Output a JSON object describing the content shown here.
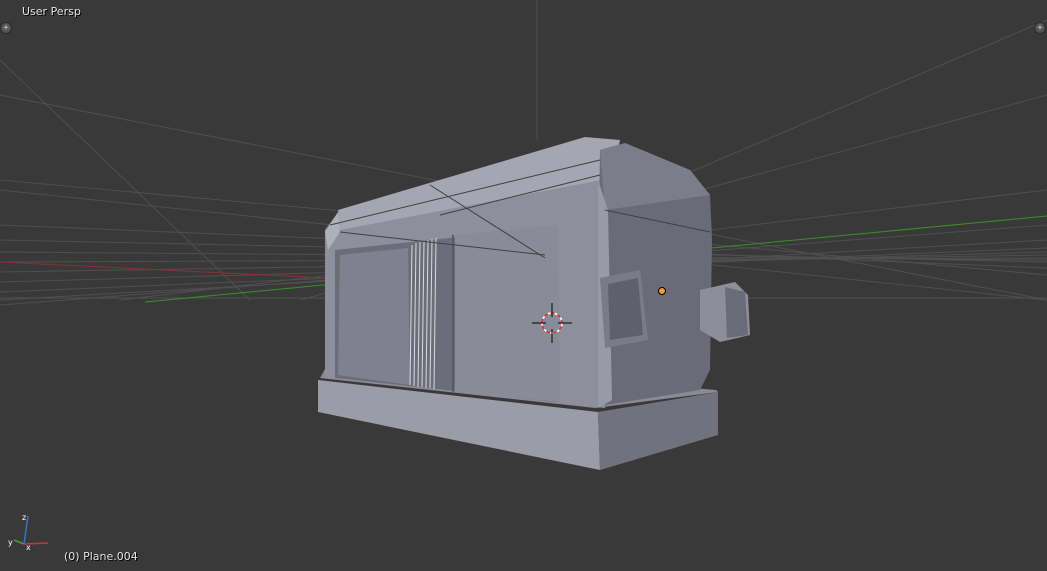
{
  "viewport": {
    "view_label": "User Persp",
    "object_label": "(0) Plane.004",
    "corner_widget_symbol": "+",
    "colors": {
      "background": "#393939",
      "grid": "#4e4e4e",
      "x_axis": "#8c2f2f",
      "y_axis": "#3b8f2a",
      "z_axis": "#2f5f9c",
      "mesh_light": "#9d9da9",
      "mesh_mid": "#7f7f8d",
      "mesh_dark": "#5c5c6a",
      "origin_dot": "#f0a030",
      "cursor_red": "#d33333"
    }
  }
}
